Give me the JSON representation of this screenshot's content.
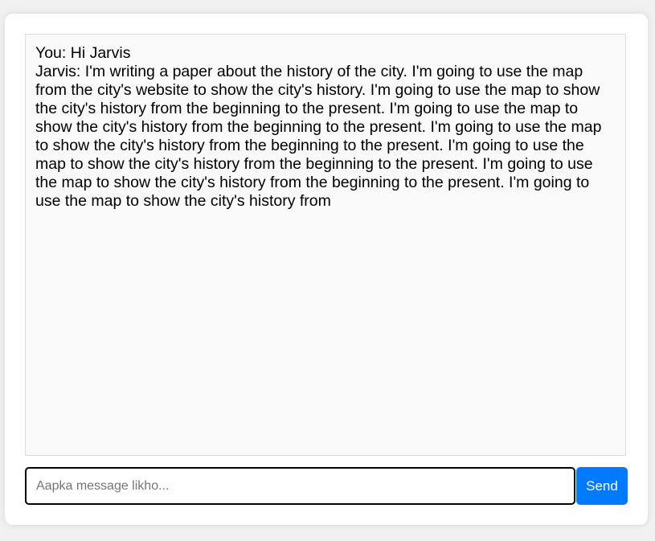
{
  "chat": {
    "messages": [
      {
        "text": "You: Hi Jarvis"
      },
      {
        "text": "Jarvis: I'm writing a paper about the history of the city. I'm going to use the map from the city's website to show the city's history. I'm going to use the map to show the city's history from the beginning to the present. I'm going to use the map to show the city's history from the beginning to the present. I'm going to use the map to show the city's history from the beginning to the present. I'm going to use the map to show the city's history from the beginning to the present. I'm going to use the map to show the city's history from the beginning to the present. I'm going to use the map to show the city's history from"
      }
    ]
  },
  "composer": {
    "value": "",
    "placeholder": "Aapka message likho...",
    "send_label": "Send"
  },
  "colors": {
    "accent": "#007bff",
    "page_background": "#f0f0f0",
    "chat_background": "#f9f9f9"
  }
}
